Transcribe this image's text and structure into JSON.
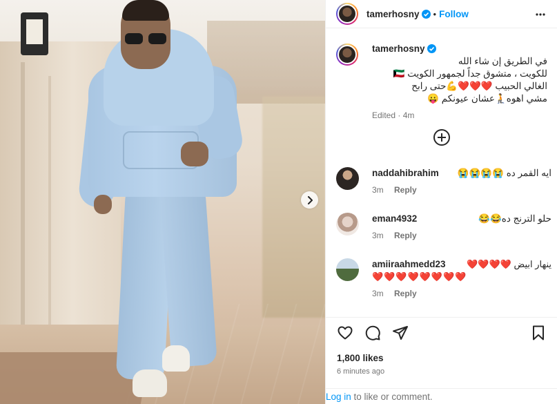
{
  "post": {
    "username": "tamerhosny",
    "follow_label": "Follow",
    "separator": "•"
  },
  "caption": {
    "username": "tamerhosny",
    "text_line1": "في الطريق إن شاء الله",
    "text_line2": "للكويت ، متشوق جداً لجمهور الكويت 🇰🇼",
    "text_line3": "الغالي الحبيب ❤️❤️❤️💪حتى رابح",
    "text_line4": "مشي اهوه🧎عشان عيونكم 😛",
    "meta": "Edited · 4m"
  },
  "comments": [
    {
      "username": "naddahibrahim",
      "text": "ايه القمر ده 😭😭😭😭",
      "time": "3m",
      "reply": "Reply"
    },
    {
      "username": "eman4932",
      "text": "حلو الترنج ده😂😂",
      "time": "3m",
      "reply": "Reply"
    },
    {
      "username": "amiiraahmedd23",
      "text": "ينهار ابيض ❤️❤️❤️❤️",
      "text2": "❤️❤️❤️❤️❤️❤️❤️❤️",
      "time": "3m",
      "reply": "Reply"
    }
  ],
  "stats": {
    "likes": "1,800 likes",
    "posted": "6 minutes ago"
  },
  "login": {
    "link": "Log in",
    "rest": " to like or comment."
  },
  "colors": {
    "accent": "#0095f6",
    "heart": "#e0245e",
    "muted": "#737373"
  }
}
